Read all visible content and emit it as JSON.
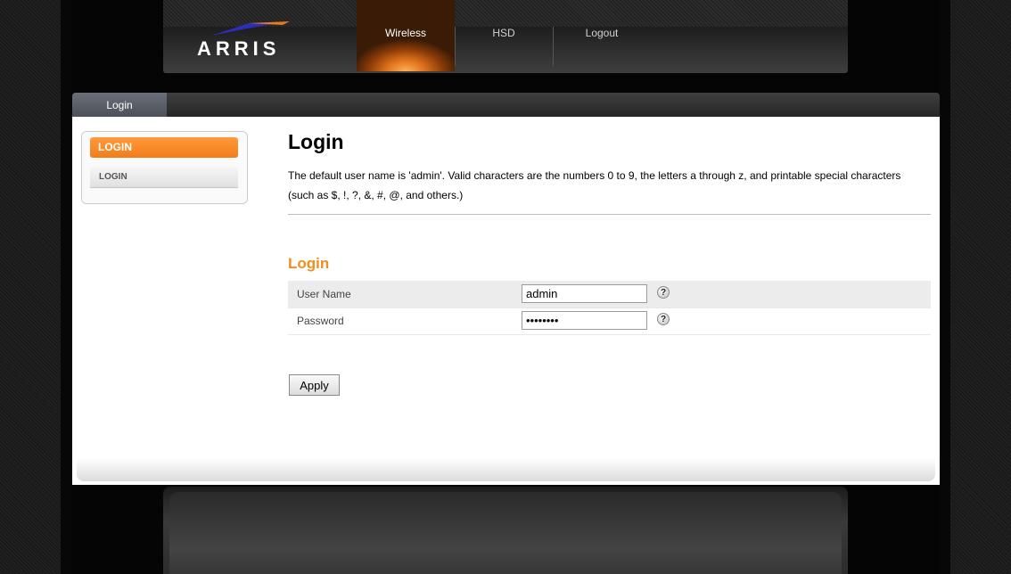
{
  "brand": {
    "logo_text": "ARRIS"
  },
  "nav": {
    "items": [
      {
        "label": "Wireless",
        "active": true
      },
      {
        "label": "HSD",
        "active": false
      },
      {
        "label": "Logout",
        "active": false
      }
    ]
  },
  "tabs": [
    {
      "label": "Login"
    }
  ],
  "sidebar": {
    "header": "LOGIN",
    "items": [
      {
        "label": "LOGIN"
      }
    ]
  },
  "main": {
    "title": "Login",
    "description": "The default user name is 'admin'. Valid characters are the numbers 0 to 9, the letters a through z, and printable special characters (such as $, !, ?, &, #, @, and others.)",
    "section_title": "Login",
    "form": {
      "username_label": "User Name",
      "username_value": "admin",
      "password_label": "Password",
      "password_value": "••••••••",
      "help_glyph": "?"
    },
    "apply_label": "Apply"
  },
  "colors": {
    "accent_orange": "#f08e1d",
    "sidebar_header": "#f07d1a",
    "tab_active": "#5b606a"
  }
}
